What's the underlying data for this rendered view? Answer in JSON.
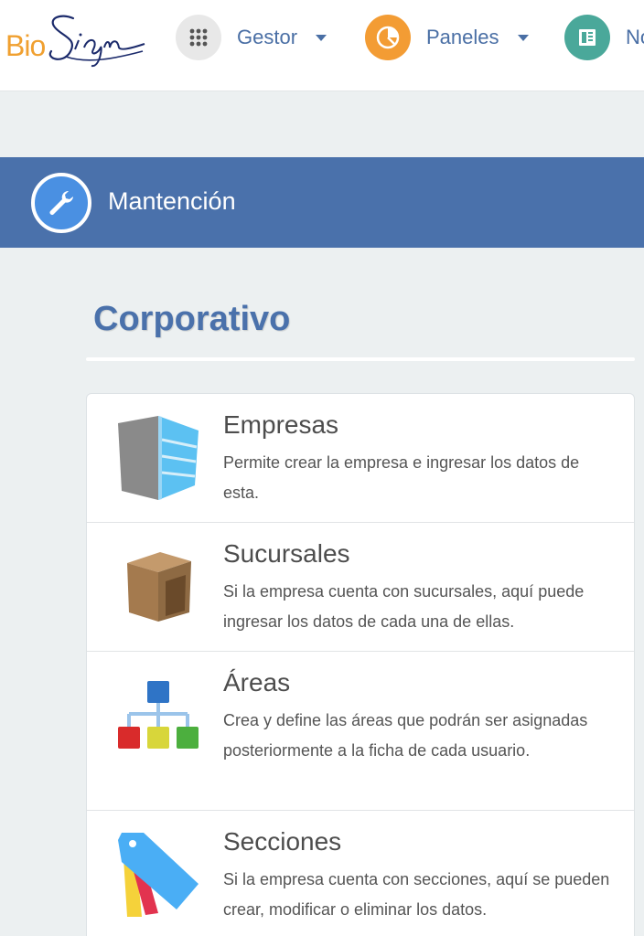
{
  "brand": {
    "logo_text": "Bio",
    "logo_signature": "Sign"
  },
  "nav": {
    "items": [
      {
        "label": "Gestor",
        "icon": "apps-grid-icon",
        "color": "#e8e8e8"
      },
      {
        "label": "Paneles",
        "icon": "pie-chart-icon",
        "color": "#f39c34"
      },
      {
        "label": "No",
        "icon": "newspaper-icon",
        "color": "#4aa89a"
      }
    ]
  },
  "section": {
    "title": "Mantención",
    "icon": "wrench-icon",
    "color": "#4a71ab"
  },
  "group": {
    "title": "Corporativo",
    "items": [
      {
        "title": "Empresas",
        "description": "Permite crear la empresa e ingresar los datos de esta.",
        "icon": "building-icon"
      },
      {
        "title": "Sucursales",
        "description": "Si la empresa cuenta con sucursales, aquí puede ingresar los datos de cada una de ellas.",
        "icon": "store-box-icon"
      },
      {
        "title": "Áreas",
        "description": "Crea y define las áreas que podrán ser asignadas posteriormente a la ficha de cada usuario.",
        "icon": "org-chart-icon"
      },
      {
        "title": "Secciones",
        "description": "Si la empresa cuenta con secciones, aquí se pueden crear, modificar o eliminar los datos.",
        "icon": "tags-icon"
      }
    ]
  }
}
